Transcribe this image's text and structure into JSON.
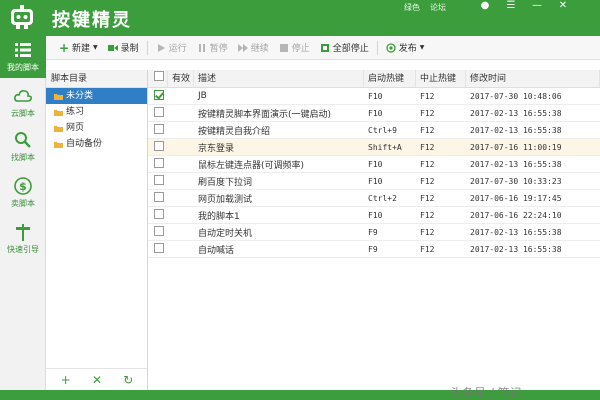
{
  "app": {
    "title": "按键精灵",
    "tb_right": [
      "绿色",
      "论坛"
    ]
  },
  "colors": {
    "brand": "#3b9d3b",
    "selection": "#2f7fc6",
    "highlight_row": "#fdf6e7"
  },
  "nav": [
    {
      "label": "我的脚本",
      "icon": "list-icon",
      "active": true
    },
    {
      "label": "云脚本",
      "icon": "cloud-icon",
      "active": false
    },
    {
      "label": "找脚本",
      "icon": "search-icon",
      "active": false
    },
    {
      "label": "卖脚本",
      "icon": "dollar-icon",
      "active": false
    },
    {
      "label": "快速引导",
      "icon": "signpost-icon",
      "active": false
    }
  ],
  "toolbar": {
    "new": "新建",
    "record": "录制",
    "run": "运行",
    "pause": "暂停",
    "resume": "继续",
    "stop": "停止",
    "stop_all": "全部停止",
    "publish": "发布"
  },
  "tree": {
    "header": "脚本目录",
    "items": [
      "未分类",
      "练习",
      "网页",
      "自动备份"
    ],
    "selected_index": 0
  },
  "table": {
    "headers": [
      "有效",
      "描述",
      "启动热键",
      "中止热键",
      "修改时间"
    ],
    "rows": [
      {
        "checked": true,
        "desc": "JB",
        "start": "F10",
        "stop": "F12",
        "time": "2017-07-30 10:48:06"
      },
      {
        "checked": false,
        "desc": "按键精灵脚本界面演示(一键启动)",
        "start": "F10",
        "stop": "F12",
        "time": "2017-02-13 16:55:38"
      },
      {
        "checked": false,
        "desc": "按键精灵自我介绍",
        "start": "Ctrl+9",
        "stop": "F12",
        "time": "2017-02-13 16:55:38"
      },
      {
        "checked": false,
        "desc": "京东登录",
        "start": "Shift+A",
        "stop": "F12",
        "time": "2017-07-16 11:00:19"
      },
      {
        "checked": false,
        "desc": "鼠标左键连点器(可调频率)",
        "start": "F10",
        "stop": "F12",
        "time": "2017-02-13 16:55:38"
      },
      {
        "checked": false,
        "desc": "刷百度下拉词",
        "start": "F10",
        "stop": "F12",
        "time": "2017-07-30 10:33:23"
      },
      {
        "checked": false,
        "desc": "网页加载测试",
        "start": "Ctrl+2",
        "stop": "F12",
        "time": "2017-06-16 19:17:45"
      },
      {
        "checked": false,
        "desc": "我的脚本1",
        "start": "F10",
        "stop": "F12",
        "time": "2017-06-16 22:24:10"
      },
      {
        "checked": false,
        "desc": "自动定时关机",
        "start": "F9",
        "stop": "F12",
        "time": "2017-02-13 16:55:38"
      },
      {
        "checked": false,
        "desc": "自动喊话",
        "start": "F9",
        "stop": "F12",
        "time": "2017-02-13 16:55:38"
      }
    ],
    "highlight_index": 3
  },
  "watermark": "头条号 / 笔记"
}
